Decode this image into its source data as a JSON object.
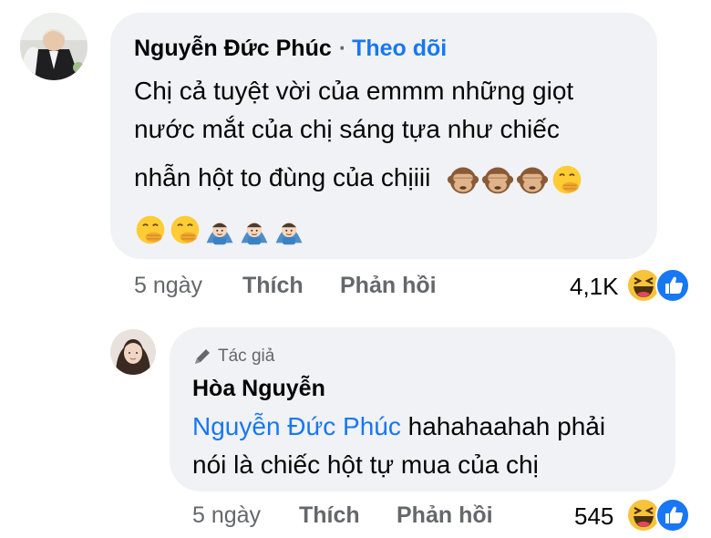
{
  "comment1": {
    "author": "Nguyễn Đức Phúc",
    "separator": "·",
    "follow_label": "Theo dõi",
    "text_lines": [
      "Chị cả tuyệt vời của emmm những giọt",
      "nước mắt của chị sáng tựa như chiếc",
      "nhẫn hột to đùng của chịiii"
    ],
    "line3_emojis": [
      "see-no-evil-monkey",
      "see-no-evil-monkey",
      "see-no-evil-monkey",
      "face-with-hand-over-mouth"
    ],
    "line4_emojis": [
      "face-with-hand-over-mouth",
      "face-with-hand-over-mouth",
      "person-gesturing-ok",
      "person-gesturing-ok",
      "person-gesturing-ok"
    ],
    "time": "5 ngày",
    "like_label": "Thích",
    "reply_label": "Phản hồi",
    "reaction_count": "4,1K",
    "reaction_icons": [
      "haha-icon",
      "like-icon"
    ]
  },
  "comment2": {
    "author_badge": "Tác giả",
    "author": "Hòa Nguyễn",
    "mention": "Nguyễn Đức Phúc",
    "text_line1_rest": " hahahaahah phải",
    "text_line2": "nói là chiếc hột tự mua của chị",
    "time": "5 ngày",
    "like_label": "Thích",
    "reply_label": "Phản hồi",
    "reaction_count": "545",
    "reaction_icons": [
      "haha-icon",
      "like-icon"
    ]
  },
  "colors": {
    "bubble": "#f0f2f5",
    "link": "#1877f2",
    "meta": "#65676b",
    "text": "#050505"
  }
}
